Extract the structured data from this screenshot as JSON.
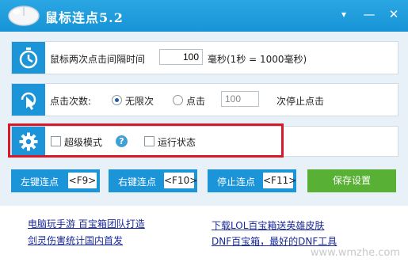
{
  "titlebar": {
    "title": "鼠标连点5.2",
    "min_glyph": "▾",
    "minimize_glyph": "—",
    "close_glyph": "✕"
  },
  "interval": {
    "label": "鼠标两次点击间隔时间",
    "value": "100",
    "unit": "毫秒(1秒 = 1000毫秒)"
  },
  "clicks": {
    "label": "点击次数:",
    "option_unlimited": "无限次",
    "option_count": "点击",
    "count_value": "100",
    "suffix": "次停止点击",
    "selected": "unlimited"
  },
  "modes": {
    "super_mode": "超级模式",
    "run_status": "运行状态",
    "help_glyph": "?"
  },
  "buttons": {
    "left": {
      "label": "左键连点",
      "key": "<F9>"
    },
    "right": {
      "label": "右键连点",
      "key": "<F10>"
    },
    "stop": {
      "label": "停止连点",
      "key": "<F11>"
    },
    "save": {
      "label": "保存设置"
    }
  },
  "links": {
    "l1": "电脑玩手游 百宝箱团队打造",
    "l2": "剑灵伤害统计国内首发",
    "r1": "下载LOL百宝箱送英雄皮肤",
    "r2": "DNF百宝箱，最好的DNF工具"
  },
  "watermark": "www.wmzhe.com",
  "colors": {
    "accent": "#1c94d8",
    "save": "#58b134",
    "highlight": "#d7192a"
  }
}
